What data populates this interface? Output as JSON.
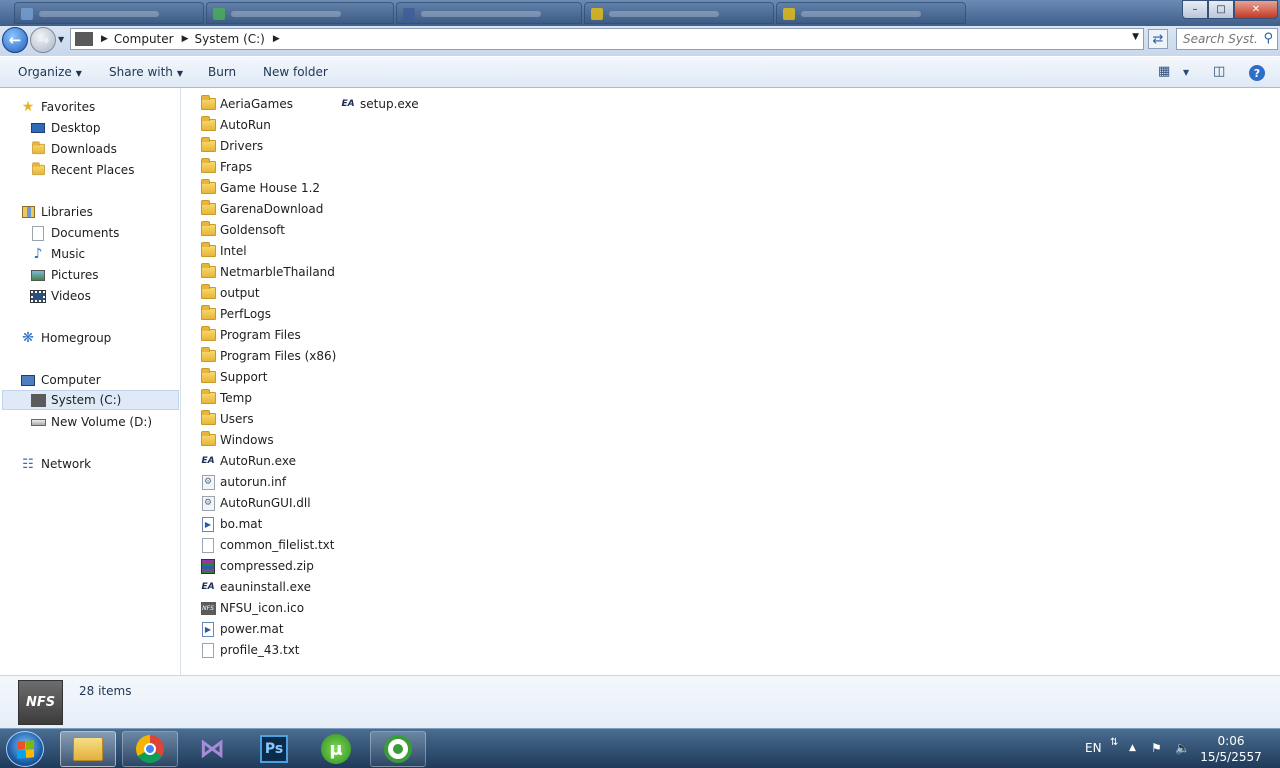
{
  "window": {
    "caption_buttons": {
      "minimize": "–",
      "maximize": "□",
      "close": "✕"
    }
  },
  "address": {
    "segments": [
      "Computer",
      "System (C:)"
    ],
    "search_placeholder": "Search Syst..."
  },
  "toolbar": {
    "organize": "Organize",
    "share_with": "Share with",
    "burn": "Burn",
    "new_folder": "New folder"
  },
  "nav": {
    "favorites": "Favorites",
    "desktop": "Desktop",
    "downloads": "Downloads",
    "recent_places": "Recent Places",
    "libraries": "Libraries",
    "documents": "Documents",
    "music": "Music",
    "pictures": "Pictures",
    "videos": "Videos",
    "homegroup": "Homegroup",
    "computer": "Computer",
    "system_c": "System (C:)",
    "new_volume_d": "New Volume (D:)",
    "network": "Network"
  },
  "files": [
    {
      "name": "AeriaGames",
      "icon": "folder-icon"
    },
    {
      "name": "AutoRun",
      "icon": "folder-icon"
    },
    {
      "name": "Drivers",
      "icon": "folder-icon"
    },
    {
      "name": "Fraps",
      "icon": "folder-icon"
    },
    {
      "name": "Game House 1.2",
      "icon": "folder-icon"
    },
    {
      "name": "GarenaDownload",
      "icon": "folder-icon"
    },
    {
      "name": "Goldensoft",
      "icon": "folder-icon"
    },
    {
      "name": "Intel",
      "icon": "folder-icon"
    },
    {
      "name": "NetmarbleThailand",
      "icon": "folder-icon"
    },
    {
      "name": "output",
      "icon": "folder-icon"
    },
    {
      "name": "PerfLogs",
      "icon": "folder-icon"
    },
    {
      "name": "Program Files",
      "icon": "folder-icon"
    },
    {
      "name": "Program Files (x86)",
      "icon": "folder-icon"
    },
    {
      "name": "Support",
      "icon": "folder-icon"
    },
    {
      "name": "Temp",
      "icon": "folder-icon"
    },
    {
      "name": "Users",
      "icon": "folder-icon"
    },
    {
      "name": "Windows",
      "icon": "folder-icon"
    },
    {
      "name": "AutoRun.exe",
      "icon": "ea-app-icon"
    },
    {
      "name": "autorun.inf",
      "icon": "settings-file-icon"
    },
    {
      "name": "AutoRunGUI.dll",
      "icon": "settings-file-icon"
    },
    {
      "name": "bo.mat",
      "icon": "mat-file-icon"
    },
    {
      "name": "common_filelist.txt",
      "icon": "text-file-icon"
    },
    {
      "name": "compressed.zip",
      "icon": "winrar-archive-icon"
    },
    {
      "name": "eauninstall.exe",
      "icon": "ea-app-icon"
    },
    {
      "name": "NFSU_icon.ico",
      "icon": "nfs-icon"
    },
    {
      "name": "power.mat",
      "icon": "mat-file-icon"
    },
    {
      "name": "profile_43.txt",
      "icon": "text-file-icon"
    },
    {
      "name": "setup.exe",
      "icon": "ea-app-icon"
    }
  ],
  "details": {
    "thumbnail_text": "NFS",
    "item_count": "28 items"
  },
  "taskbar": {
    "language": "EN",
    "time": "0:06",
    "date": "15/5/2557"
  }
}
